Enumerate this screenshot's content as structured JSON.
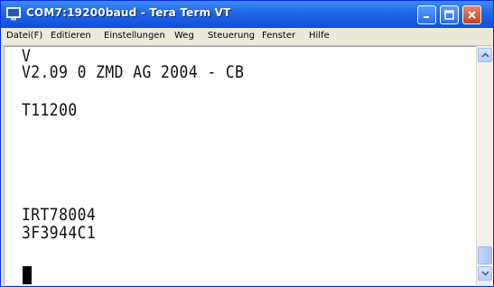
{
  "window": {
    "title": "COM7:19200baud - Tera Term VT",
    "controls": {
      "minimize": "minimize-icon",
      "maximize": "maximize-icon",
      "close": "close-icon"
    }
  },
  "menu": {
    "items": [
      {
        "label": "Datei(F)"
      },
      {
        "label": "Editieren"
      },
      {
        "label": "Einstellungen"
      },
      {
        "label": "Weg"
      },
      {
        "label": "Steuerung"
      },
      {
        "label": "Fenster"
      },
      {
        "label": "Hilfe"
      }
    ]
  },
  "terminal": {
    "lines": [
      "V",
      "V2.09 0 ZMD AG 2004 - CB",
      "",
      "T11200",
      "",
      "",
      "IRT78004",
      "3F3944C1"
    ]
  },
  "scrollbar": {
    "up_icon": "chevron-up-icon",
    "down_icon": "chevron-down-icon"
  },
  "colors": {
    "titlebar": "#1f66e8",
    "close_button": "#c7401c",
    "menubar": "#ece9d8",
    "terminal_bg": "#ffffff",
    "text": "#111111"
  }
}
